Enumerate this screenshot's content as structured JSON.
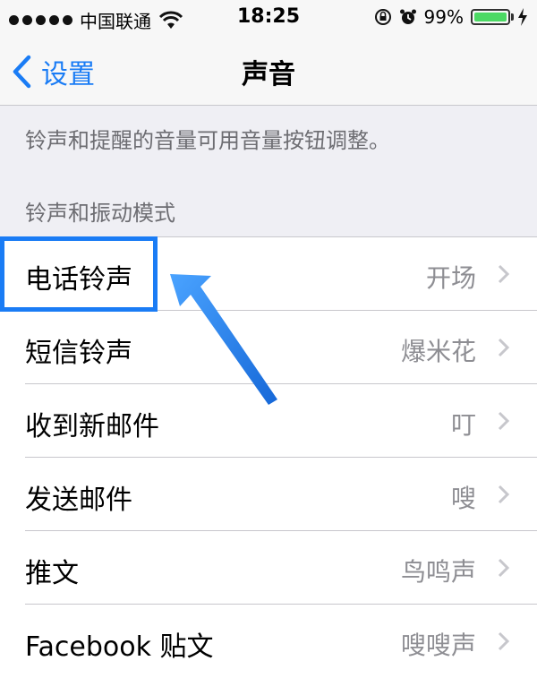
{
  "status": {
    "carrier": "中国联通",
    "time": "18:25",
    "battery": "99%",
    "battery_level": 0.99
  },
  "nav": {
    "back_label": "设置",
    "title": "声音"
  },
  "volume_note": "铃声和提醒的音量可用音量按钮调整。",
  "section_title": "铃声和振动模式",
  "rows": [
    {
      "label": "电话铃声",
      "value": "开场"
    },
    {
      "label": "短信铃声",
      "value": "爆米花"
    },
    {
      "label": "收到新邮件",
      "value": "叮"
    },
    {
      "label": "发送邮件",
      "value": "嗖"
    },
    {
      "label": "推文",
      "value": "鸟鸣声"
    },
    {
      "label": "Facebook 贴文",
      "value": "嗖嗖声"
    }
  ],
  "colors": {
    "accent": "#1a7cf5",
    "battery": "#4cd964",
    "secondary_text": "#8e8e93"
  }
}
